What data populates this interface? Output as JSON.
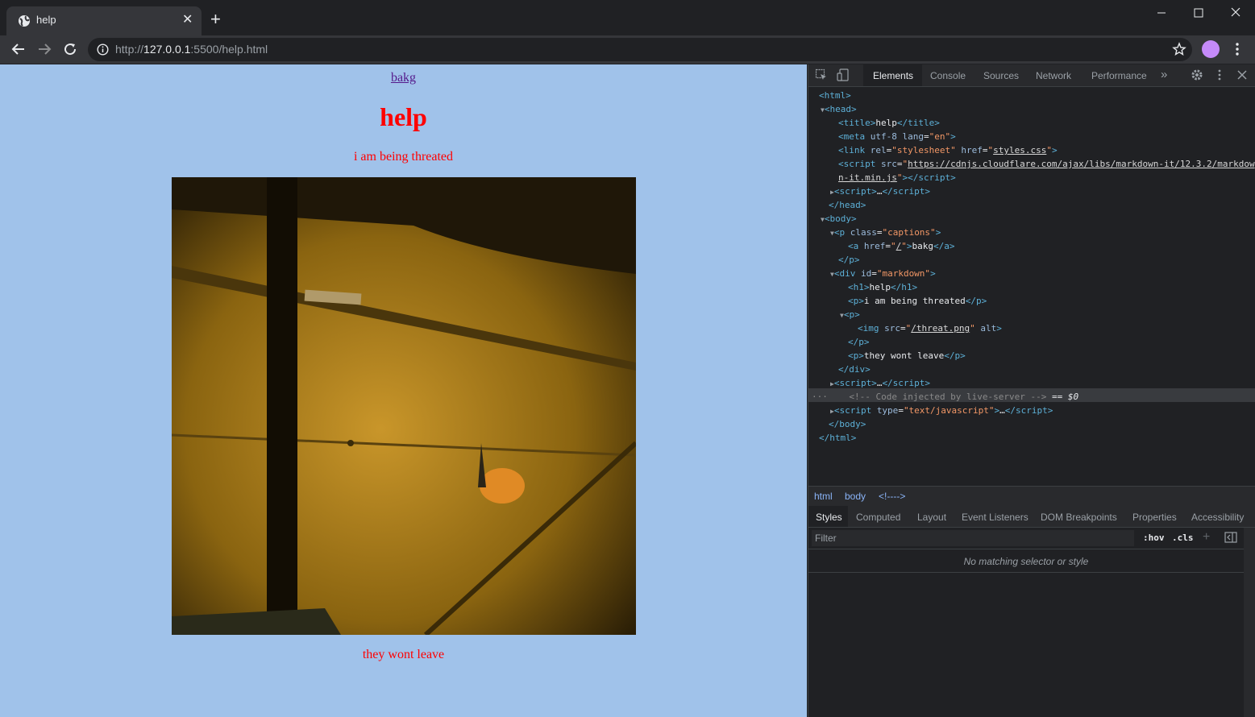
{
  "browser": {
    "tab_title": "help",
    "url_scheme": "http://",
    "url_host": "127.0.0.1",
    "url_rest": ":5500/help.html"
  },
  "page": {
    "link_text": "bakg",
    "heading": "help",
    "paragraph1": "i am being threated",
    "paragraph2": "they wont leave",
    "colors": {
      "background": "#a0c2ea",
      "text": "#ff0000"
    }
  },
  "devtools": {
    "tabs": [
      "Elements",
      "Console",
      "Sources",
      "Network",
      "Performance"
    ],
    "active_tab": "Elements",
    "breadcrumbs": [
      "html",
      "body",
      "<!---->"
    ],
    "styles_tabs": [
      "Styles",
      "Computed",
      "Layout",
      "Event Listeners",
      "DOM Breakpoints",
      "Properties",
      "Accessibility"
    ],
    "filter_placeholder": "Filter",
    "hov_label": ":hov",
    "cls_label": ".cls",
    "no_match_text": "No matching selector or style",
    "selected_suffix": "== $0"
  }
}
